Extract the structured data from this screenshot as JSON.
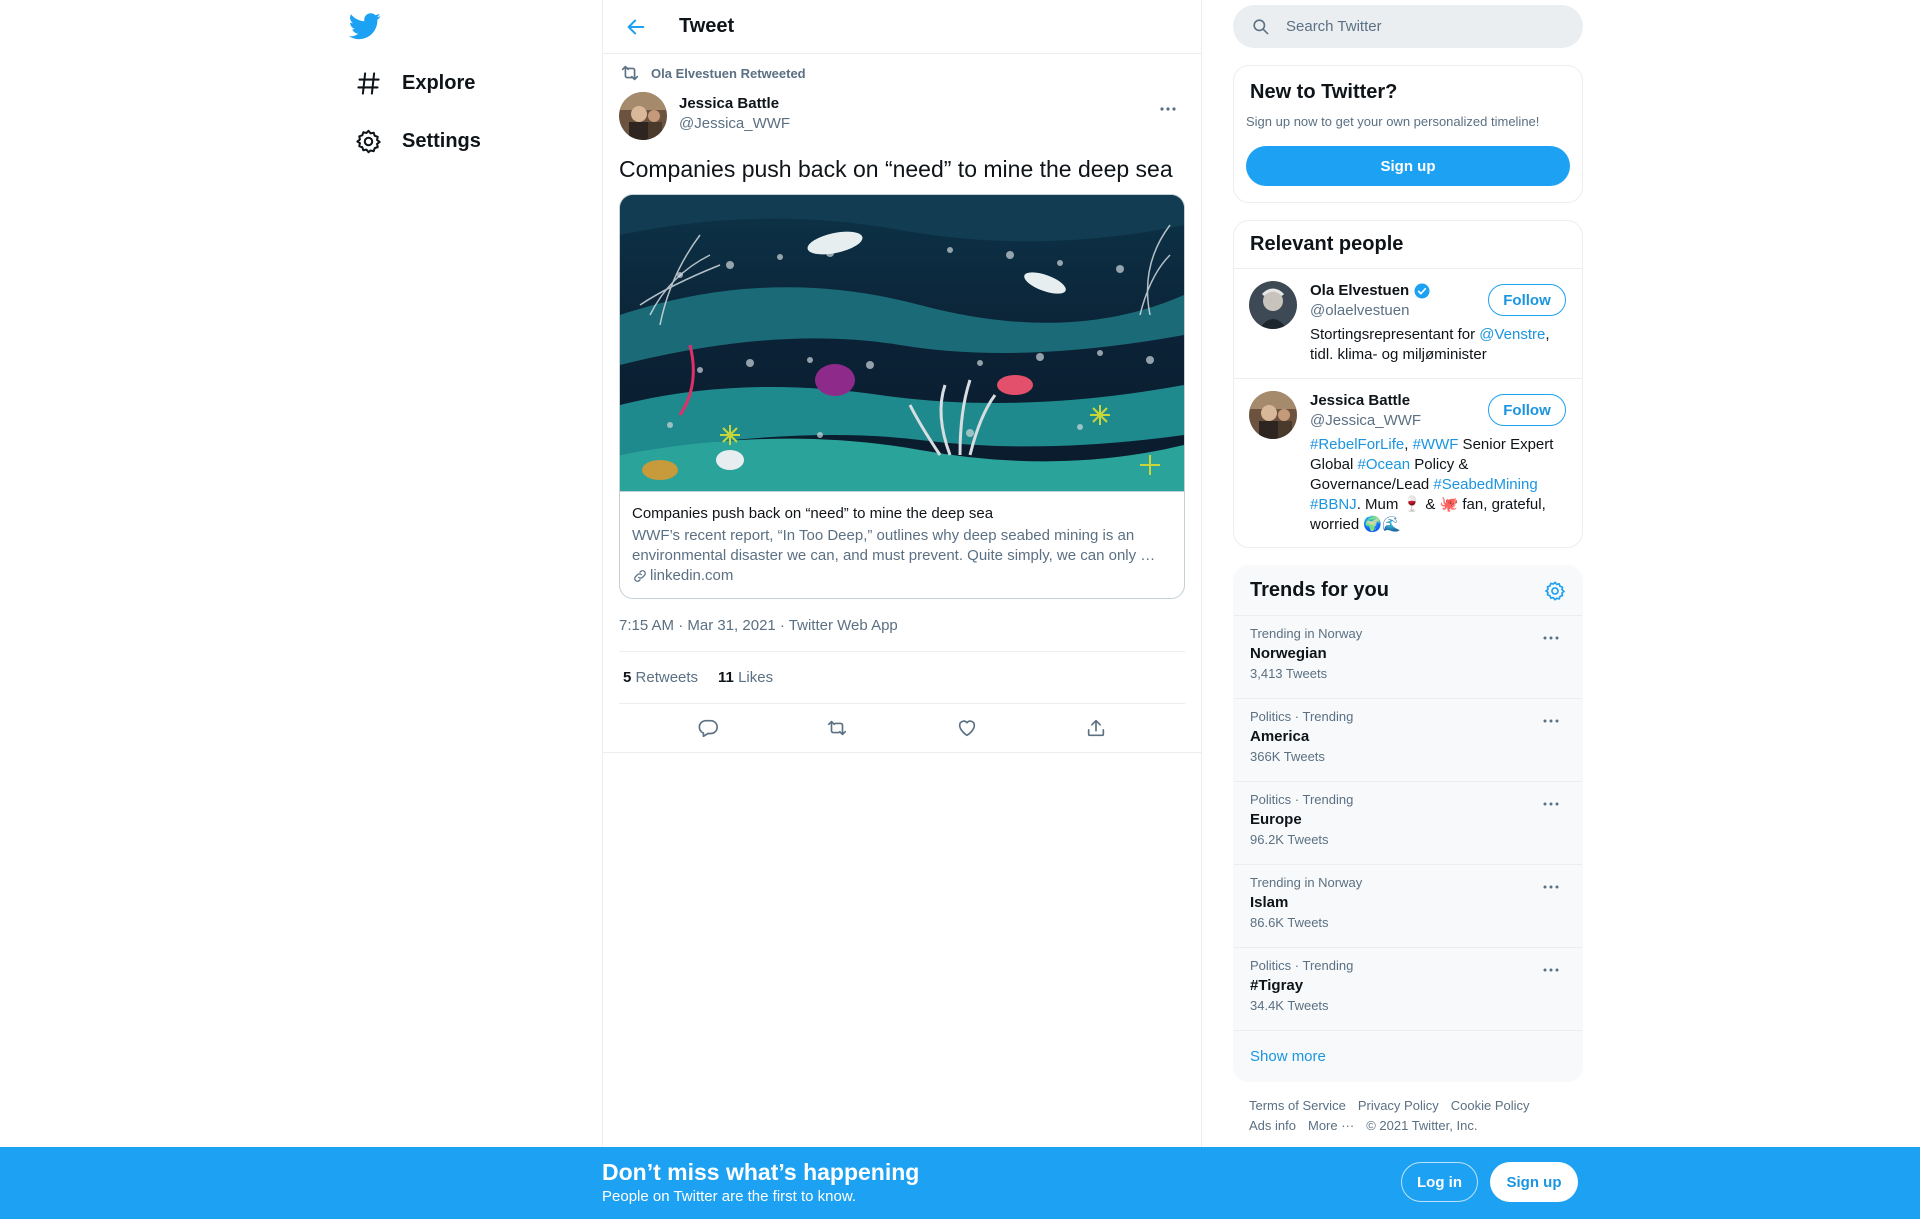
{
  "colors": {
    "brand": "#1da1f2",
    "link": "#1b95e0",
    "text": "#0f1419",
    "secondary": "#5b7083",
    "border": "#ebeef0"
  },
  "nav": {
    "logo_icon": "twitter-bird-icon",
    "items": [
      {
        "label": "Explore",
        "icon": "hashtag-icon"
      },
      {
        "label": "Settings",
        "icon": "gear-icon"
      }
    ]
  },
  "header": {
    "back_icon": "arrow-left-icon",
    "title": "Tweet"
  },
  "tweet": {
    "retweet_context": "Ola Elvestuen Retweeted",
    "author_name": "Jessica Battle",
    "author_handle": "@Jessica_WWF",
    "text": "Companies push back on “need” to mine the deep sea",
    "card": {
      "title": "Companies push back on “need” to mine the deep sea",
      "description": "WWF’s recent report, “In Too Deep,” outlines why deep seabed mining is an environmental disaster we can, and must prevent. Quite simply, we can only …",
      "domain": "linkedin.com"
    },
    "timestamp": "7:15 AM · Mar 31, 2021 · Twitter Web App",
    "retweets_count": "5",
    "retweets_label": "Retweets",
    "likes_count": "11",
    "likes_label": "Likes",
    "actions": [
      "reply-icon",
      "retweet-icon",
      "like-icon",
      "share-icon"
    ]
  },
  "search": {
    "placeholder": "Search Twitter"
  },
  "signup_box": {
    "title": "New to Twitter?",
    "subtitle": "Sign up now to get your own personalized timeline!",
    "button": "Sign up"
  },
  "relevant_people": {
    "title": "Relevant people",
    "people": [
      {
        "name": "Ola Elvestuen",
        "verified": true,
        "handle": "@olaelvestuen",
        "follow": "Follow",
        "bio": {
          "t1": "Stortingsrepresentant for ",
          "l1": "@Venstre",
          "t2": ", tidl. klima- og miljøminister"
        }
      },
      {
        "name": "Jessica Battle",
        "verified": false,
        "handle": "@Jessica_WWF",
        "follow": "Follow",
        "bio": {
          "l1": "#RebelForLife",
          "t1": ", ",
          "l2": "#WWF",
          "t2": " Senior Expert Global ",
          "l3": "#Ocean",
          "t3": " Policy & Governance/Lead ",
          "l4": "#SeabedMining",
          "t4": " ",
          "l5": "#BBNJ",
          "t5": ". Mum 🍷 & 🐙 fan, grateful, worried 🌍🌊"
        }
      }
    ]
  },
  "trends": {
    "title": "Trends for you",
    "settings_icon": "gear-icon",
    "items": [
      {
        "context": "Trending in Norway",
        "name": "Norwegian",
        "count": "3,413 Tweets"
      },
      {
        "context": "Politics · Trending",
        "name": "America",
        "count": "366K Tweets"
      },
      {
        "context": "Politics · Trending",
        "name": "Europe",
        "count": "96.2K Tweets"
      },
      {
        "context": "Trending in Norway",
        "name": "Islam",
        "count": "86.6K Tweets"
      },
      {
        "context": "Politics · Trending",
        "name": "#Tigray",
        "count": "34.4K Tweets"
      }
    ],
    "show_more": "Show more"
  },
  "footer": {
    "terms": "Terms of Service",
    "privacy": "Privacy Policy",
    "cookie": "Cookie Policy",
    "ads": "Ads info",
    "more": "More ···",
    "copyright": "© 2021 Twitter, Inc."
  },
  "bottom_bar": {
    "title": "Don’t miss what’s happening",
    "subtitle": "People on Twitter are the first to know.",
    "login": "Log in",
    "signup": "Sign up"
  }
}
